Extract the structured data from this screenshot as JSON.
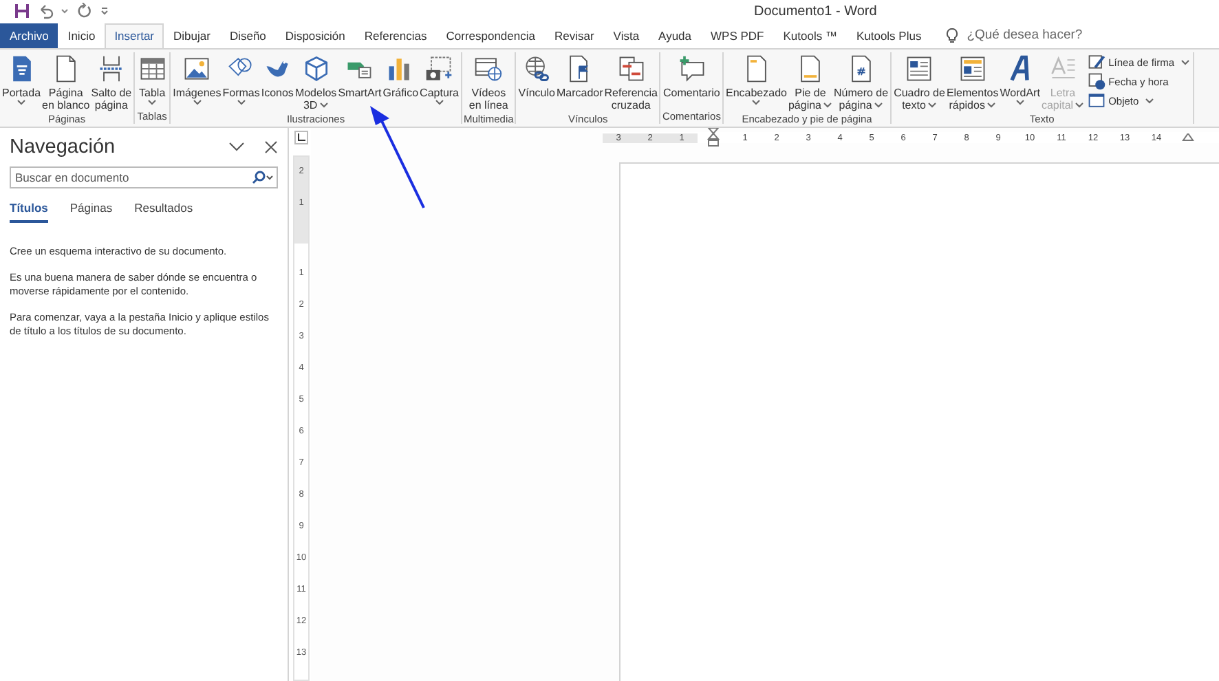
{
  "window": {
    "title": "Documento1 - Word"
  },
  "tabs": [
    {
      "label": "Archivo",
      "kind": "file",
      "selected": false
    },
    {
      "label": "Inicio",
      "kind": "tab",
      "selected": false
    },
    {
      "label": "Insertar",
      "kind": "tab",
      "selected": true
    },
    {
      "label": "Dibujar",
      "kind": "tab",
      "selected": false
    },
    {
      "label": "Diseño",
      "kind": "tab",
      "selected": false
    },
    {
      "label": "Disposición",
      "kind": "tab",
      "selected": false
    },
    {
      "label": "Referencias",
      "kind": "tab",
      "selected": false
    },
    {
      "label": "Correspondencia",
      "kind": "tab",
      "selected": false
    },
    {
      "label": "Revisar",
      "kind": "tab",
      "selected": false
    },
    {
      "label": "Vista",
      "kind": "tab",
      "selected": false
    },
    {
      "label": "Ayuda",
      "kind": "tab",
      "selected": false
    },
    {
      "label": "WPS PDF",
      "kind": "tab",
      "selected": false
    },
    {
      "label": "Kutools ™",
      "kind": "tab",
      "selected": false
    },
    {
      "label": "Kutools Plus",
      "kind": "tab",
      "selected": false
    }
  ],
  "tell_me": {
    "placeholder": "¿Qué desea hacer?"
  },
  "ribbon": [
    {
      "label": "Páginas",
      "buttons": [
        {
          "label": "Portada",
          "dropdown": true,
          "disabled": false
        },
        {
          "label": "Página\nen blanco",
          "dropdown": false,
          "disabled": false
        },
        {
          "label": "Salto de\npágina",
          "dropdown": false,
          "disabled": false
        }
      ]
    },
    {
      "label": "Tablas",
      "buttons": [
        {
          "label": "Tabla",
          "dropdown": true,
          "disabled": false
        }
      ]
    },
    {
      "label": "Ilustraciones",
      "buttons": [
        {
          "label": "Imágenes",
          "dropdown": true,
          "disabled": false
        },
        {
          "label": "Formas",
          "dropdown": true,
          "disabled": false
        },
        {
          "label": "Iconos",
          "dropdown": false,
          "disabled": false
        },
        {
          "label": "Modelos\n3D",
          "dropdown": true,
          "disabled": false
        },
        {
          "label": "SmartArt",
          "dropdown": false,
          "disabled": false
        },
        {
          "label": "Gráfico",
          "dropdown": false,
          "disabled": false
        },
        {
          "label": "Captura",
          "dropdown": true,
          "disabled": false
        }
      ]
    },
    {
      "label": "Multimedia",
      "buttons": [
        {
          "label": "Vídeos\nen línea",
          "dropdown": false,
          "disabled": false
        }
      ]
    },
    {
      "label": "Vínculos",
      "buttons": [
        {
          "label": "Vínculo",
          "dropdown": false,
          "disabled": false
        },
        {
          "label": "Marcador",
          "dropdown": false,
          "disabled": false
        },
        {
          "label": "Referencia\ncruzada",
          "dropdown": false,
          "disabled": false
        }
      ]
    },
    {
      "label": "Comentarios",
      "buttons": [
        {
          "label": "Comentario",
          "dropdown": false,
          "disabled": false
        }
      ]
    },
    {
      "label": "Encabezado y pie de página",
      "buttons": [
        {
          "label": "Encabezado",
          "dropdown": true,
          "disabled": false
        },
        {
          "label": "Pie de\npágina",
          "dropdown": true,
          "disabled": false
        },
        {
          "label": "Número de\npágina",
          "dropdown": true,
          "disabled": false
        }
      ]
    },
    {
      "label": "Texto",
      "buttons": [
        {
          "label": "Cuadro de\ntexto",
          "dropdown": true,
          "disabled": false
        },
        {
          "label": "Elementos\nrápidos",
          "dropdown": true,
          "disabled": false
        },
        {
          "label": "WordArt",
          "dropdown": true,
          "disabled": false
        },
        {
          "label": "Letra\ncapital",
          "dropdown": true,
          "disabled": true
        }
      ],
      "small": [
        {
          "label": "Línea de firma",
          "dropdown": true
        },
        {
          "label": "Fecha y hora",
          "dropdown": false
        },
        {
          "label": "Objeto",
          "dropdown": true
        }
      ]
    }
  ],
  "navigation": {
    "title": "Navegación",
    "search": {
      "placeholder": "Buscar en documento"
    },
    "tabs": [
      {
        "label": "Títulos",
        "selected": true
      },
      {
        "label": "Páginas",
        "selected": false
      },
      {
        "label": "Resultados",
        "selected": false
      }
    ],
    "paragraphs": [
      "Cree un esquema interactivo de su documento.",
      "Es una buena manera de saber dónde se encuentra o moverse rápidamente por el contenido.",
      "Para comenzar, vaya a la pestaña Inicio y aplique estilos de título a los títulos de su documento."
    ]
  },
  "ruler": {
    "left_labels": [
      "3",
      "2",
      "1"
    ],
    "right_labels": [
      "1",
      "2",
      "3",
      "4",
      "5",
      "6",
      "7",
      "8",
      "9",
      "10",
      "11",
      "12",
      "13",
      "14"
    ]
  },
  "vertical_ruler": {
    "top_labels": [
      "2",
      "1"
    ],
    "labels": [
      "1",
      "2",
      "3",
      "4",
      "5",
      "6",
      "7",
      "8",
      "9",
      "10",
      "11",
      "12",
      "13"
    ]
  }
}
